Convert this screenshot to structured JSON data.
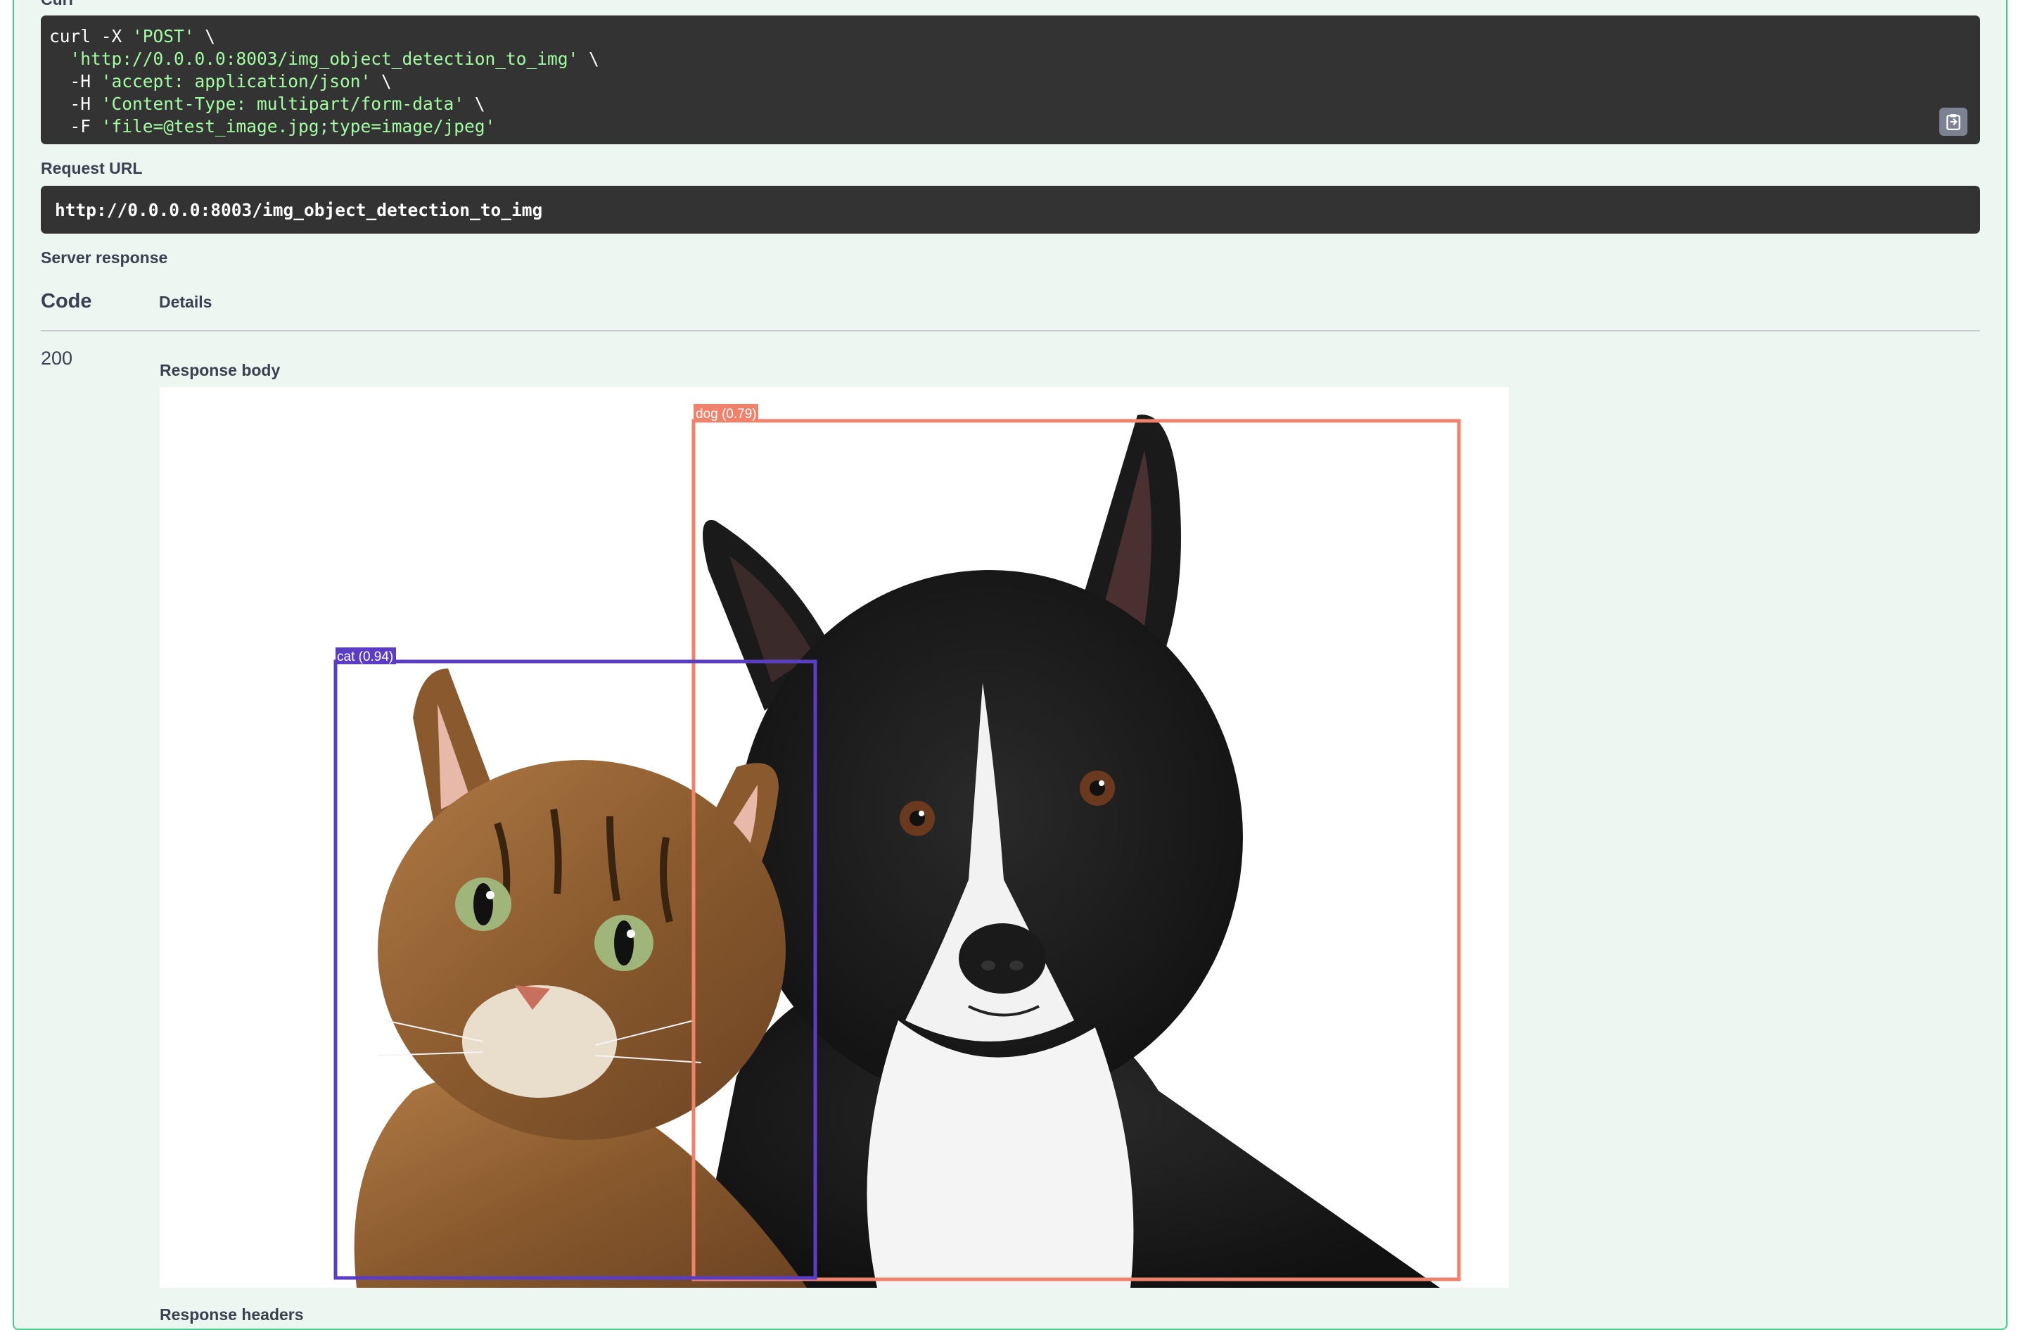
{
  "curl": {
    "section_label": "Curl",
    "lines": [
      {
        "plain": "curl -X ",
        "str": "'POST'",
        "tail": " \\"
      },
      {
        "plain": "  ",
        "str": "'http://0.0.0.0:8003/img_object_detection_to_img'",
        "tail": " \\"
      },
      {
        "plain": "  -H ",
        "str": "'accept: application/json'",
        "tail": " \\"
      },
      {
        "plain": "  -H ",
        "str": "'Content-Type: multipart/form-data'",
        "tail": " \\"
      },
      {
        "plain": "  -F ",
        "str": "'file=@test_image.jpg;type=image/jpeg'",
        "tail": ""
      }
    ],
    "copy_icon": "clipboard-icon"
  },
  "request_url": {
    "label": "Request URL",
    "value": "http://0.0.0.0:8003/img_object_detection_to_img"
  },
  "server_response": {
    "label": "Server response",
    "header_code": "Code",
    "header_details": "Details",
    "code": "200",
    "response_body_label": "Response body",
    "response_headers_label": "Response headers"
  },
  "detections": [
    {
      "label": "dog (0.79)",
      "color": "#f0826c"
    },
    {
      "label": "cat (0.94)",
      "color": "#5b3cc4"
    }
  ],
  "colors": {
    "accent_green": "#49cc90",
    "block_bg": "#ebf7f0",
    "code_bg": "#333333",
    "string_green": "#a2fca2"
  }
}
